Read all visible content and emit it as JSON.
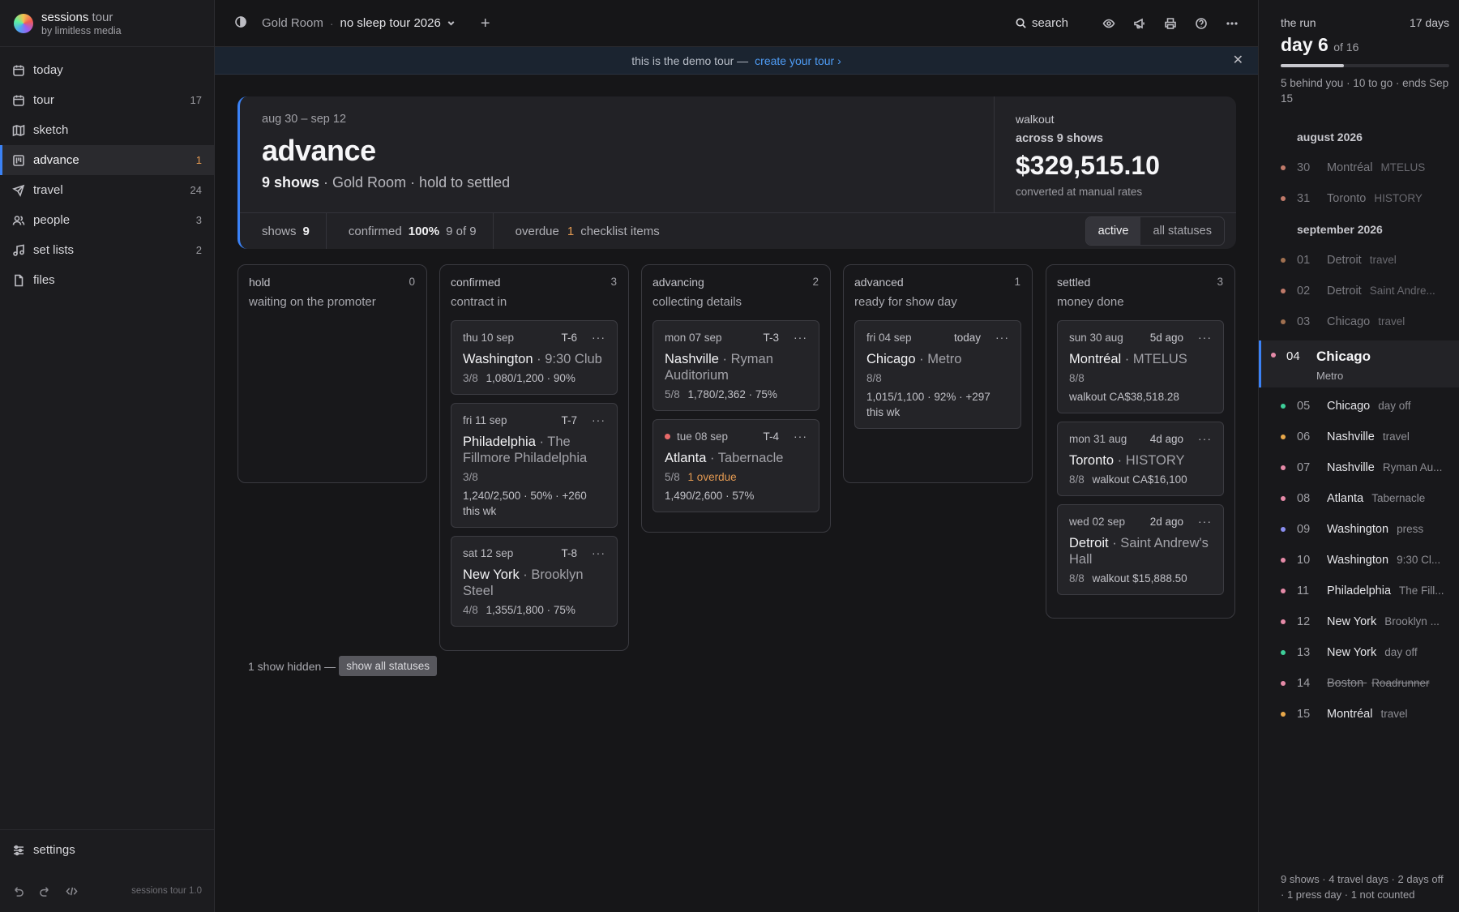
{
  "brand": {
    "name": "sessions",
    "name_suffix": "tour",
    "subtitle": "by limitless media"
  },
  "sidebar": {
    "items": [
      {
        "label": "today",
        "count": "",
        "icon": "calendar-today-icon"
      },
      {
        "label": "tour",
        "count": "17",
        "icon": "calendar-icon"
      },
      {
        "label": "sketch",
        "count": "",
        "icon": "map-icon"
      },
      {
        "label": "advance",
        "count": "1",
        "icon": "kanban-icon"
      },
      {
        "label": "travel",
        "count": "24",
        "icon": "plane-icon"
      },
      {
        "label": "people",
        "count": "3",
        "icon": "people-icon"
      },
      {
        "label": "set lists",
        "count": "2",
        "icon": "music-icon"
      },
      {
        "label": "files",
        "count": "",
        "icon": "file-icon"
      }
    ],
    "settings_label": "settings",
    "version": "sessions tour 1.0"
  },
  "topbar": {
    "room": "Gold Room",
    "separator": "·",
    "tour": "no sleep tour 2026",
    "search_label": "search"
  },
  "banner": {
    "text": "this is the demo tour —",
    "link": "create your tour ›"
  },
  "header": {
    "dates": "aug 30 – sep 12",
    "title": "advance",
    "shows_label": "9 shows",
    "sub_rest": " · Gold Room · hold to settled",
    "walkout_label": "walkout",
    "walkout_across": "across 9 shows",
    "walkout_amount": "$329,515.10",
    "walkout_note": "converted at manual rates",
    "stats": {
      "shows_label": "shows",
      "shows_value": "9",
      "confirmed_label": "confirmed",
      "confirmed_pct": "100%",
      "confirmed_frac": "9 of 9",
      "overdue_label": "overdue",
      "overdue_value": "1",
      "overdue_suffix": "checklist items"
    },
    "filter": {
      "active": "active",
      "all": "all statuses"
    }
  },
  "columns": [
    {
      "name": "hold",
      "count": "0",
      "subtitle": "waiting on the promoter",
      "cards": []
    },
    {
      "name": "confirmed",
      "count": "3",
      "subtitle": "contract in",
      "cards": [
        {
          "date": "thu 10 sep",
          "t": "T-6",
          "city": "Washington",
          "venue": "9:30 Club",
          "line1": "3/8",
          "line1b": "1,080/1,200 · 90%",
          "line2": ""
        },
        {
          "date": "fri 11 sep",
          "t": "T-7",
          "city": "Philadelphia",
          "venue": "The Fillmore Philadelphia",
          "line1": "3/8",
          "line1b": "",
          "line2": "1,240/2,500 · 50% · +260 this wk"
        },
        {
          "date": "sat 12 sep",
          "t": "T-8",
          "city": "New York",
          "venue": "Brooklyn Steel",
          "line1": "4/8",
          "line1b": "1,355/1,800 · 75%",
          "line2": ""
        }
      ]
    },
    {
      "name": "advancing",
      "count": "2",
      "subtitle": "collecting details",
      "cards": [
        {
          "date": "mon 07 sep",
          "t": "T-3",
          "city": "Nashville",
          "venue": "Ryman Auditorium",
          "line1": "5/8",
          "line1b": "1,780/2,362 · 75%",
          "line2": ""
        },
        {
          "date": "tue 08 sep",
          "t": "T-4",
          "city": "Atlanta",
          "venue": "Tabernacle",
          "line1": "5/8",
          "overdue": "1 overdue",
          "line1b": "",
          "line2": "1,490/2,600 · 57%"
        }
      ]
    },
    {
      "name": "advanced",
      "count": "1",
      "subtitle": "ready for show day",
      "cards": [
        {
          "date": "fri 04 sep",
          "t": "today",
          "city": "Chicago",
          "venue": "Metro",
          "line1": "8/8",
          "line1b": "",
          "line2": "1,015/1,100 · 92% · +297 this wk"
        }
      ]
    },
    {
      "name": "settled",
      "count": "3",
      "subtitle": "money done",
      "cards": [
        {
          "date": "sun 30 aug",
          "t": "5d ago",
          "city": "Montréal",
          "venue": "MTELUS",
          "line1": "8/8",
          "line1b": "",
          "line2": "walkout CA$38,518.28"
        },
        {
          "date": "mon 31 aug",
          "t": "4d ago",
          "city": "Toronto",
          "venue": "HISTORY",
          "line1": "8/8",
          "line1b": "walkout CA$16,100",
          "line2": ""
        },
        {
          "date": "wed 02 sep",
          "t": "2d ago",
          "city": "Detroit",
          "venue": "Saint Andrew's Hall",
          "line1": "8/8",
          "line1b": "walkout $15,888.50",
          "line2": ""
        }
      ]
    }
  ],
  "hidden": {
    "text": "1 show hidden —",
    "button": "show all statuses"
  },
  "run": {
    "label": "the run",
    "total": "17 days",
    "day": "day 6",
    "of": "of 16",
    "progress_fraction": 0.375,
    "note": "5 behind you · 10 to go · ends Sep 15",
    "month1": "august 2026",
    "month2": "september 2026",
    "days": [
      {
        "num": "30",
        "city": "Montréal",
        "venue": "MTELUS",
        "color": "#c07a6a",
        "past": true
      },
      {
        "num": "31",
        "city": "Toronto",
        "venue": "HISTORY",
        "color": "#c07a6a",
        "past": true
      },
      {
        "num": "01",
        "city": "Detroit",
        "venue": "travel",
        "color": "#a07050",
        "past": true
      },
      {
        "num": "02",
        "city": "Detroit",
        "venue": "Saint Andre...",
        "color": "#c07a6a",
        "past": true
      },
      {
        "num": "03",
        "city": "Chicago",
        "venue": "travel",
        "color": "#a07050",
        "past": true
      },
      {
        "num": "04",
        "city": "Chicago",
        "venue": "Metro",
        "color": "#e58aa8",
        "today": true
      },
      {
        "num": "05",
        "city": "Chicago",
        "venue": "day off",
        "color": "#3ecf9a"
      },
      {
        "num": "06",
        "city": "Nashville",
        "venue": "travel",
        "color": "#e8a84a"
      },
      {
        "num": "07",
        "city": "Nashville",
        "venue": "Ryman Au...",
        "color": "#e58aa8"
      },
      {
        "num": "08",
        "city": "Atlanta",
        "venue": "Tabernacle",
        "color": "#e58aa8"
      },
      {
        "num": "09",
        "city": "Washington",
        "venue": "press",
        "color": "#8a8ef0"
      },
      {
        "num": "10",
        "city": "Washington",
        "venue": "9:30 Cl...",
        "color": "#e58aa8"
      },
      {
        "num": "11",
        "city": "Philadelphia",
        "venue": "The Fill...",
        "color": "#e58aa8"
      },
      {
        "num": "12",
        "city": "New York",
        "venue": "Brooklyn ...",
        "color": "#e58aa8"
      },
      {
        "num": "13",
        "city": "New York",
        "venue": "day off",
        "color": "#3ecf9a"
      },
      {
        "num": "14",
        "city": "Boston",
        "venue": "Roadrunner",
        "color": "#e58aa8",
        "struck": true
      },
      {
        "num": "15",
        "city": "Montréal",
        "venue": "travel",
        "color": "#e8a84a"
      }
    ],
    "footer": "9 shows · 4 travel days · 2 days off · 1 press day · 1 not counted"
  }
}
